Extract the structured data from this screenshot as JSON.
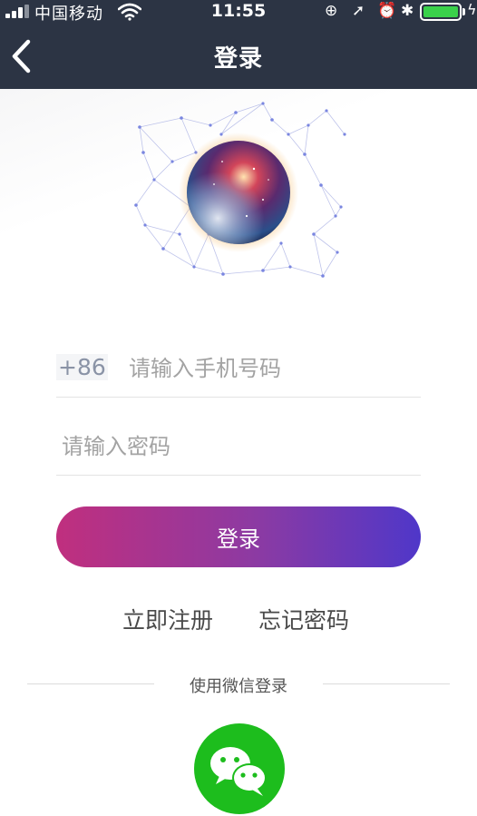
{
  "status_bar": {
    "carrier": "中国移动",
    "time": "11:55"
  },
  "nav": {
    "title": "登录"
  },
  "form": {
    "country_code": "+86",
    "phone_placeholder": "请输入手机号码",
    "phone_value": "",
    "password_placeholder": "请输入密码",
    "password_value": "",
    "login_label": "登录"
  },
  "links": {
    "register": "立即注册",
    "forgot_password": "忘记密码"
  },
  "social": {
    "wechat_label": "使用微信登录"
  },
  "colors": {
    "nav_bg": "#2c3444",
    "button_gradient_start": "#c02f7e",
    "button_gradient_end": "#4f37c9",
    "wechat_green": "#1dbd1d",
    "battery_green": "#3ad14b"
  },
  "icons": {
    "back": "chevron-left-icon",
    "wifi": "wifi-icon",
    "orientation_lock": "orientation-lock-icon",
    "location": "location-arrow-icon",
    "alarm": "alarm-icon",
    "bluetooth": "bluetooth-icon",
    "battery": "battery-icon",
    "wechat": "wechat-icon"
  }
}
